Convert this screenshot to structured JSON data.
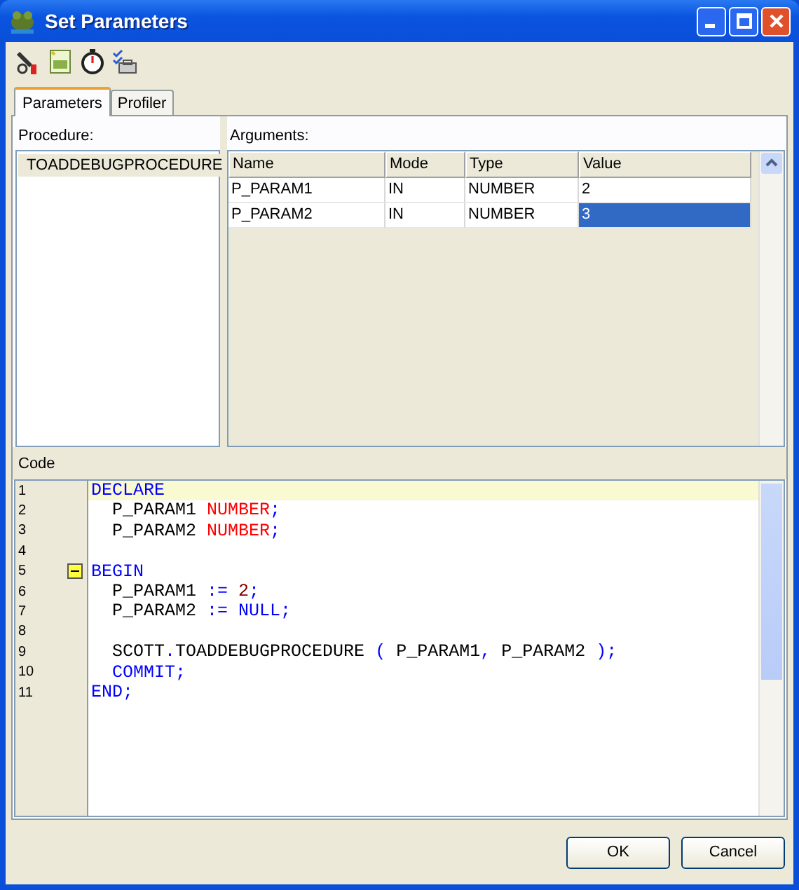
{
  "window": {
    "title": "Set Parameters"
  },
  "tabs": [
    {
      "label": "Parameters",
      "selected": true
    },
    {
      "label": "Profiler",
      "selected": false
    }
  ],
  "procedure": {
    "label": "Procedure:",
    "items": [
      {
        "name": "TOADDEBUGPROCEDURE",
        "selected": true
      }
    ]
  },
  "arguments": {
    "label": "Arguments:",
    "columns": [
      "Name",
      "Mode",
      "Type",
      "Value"
    ],
    "rows": [
      {
        "cells": [
          "P_PARAM1",
          "IN",
          "NUMBER",
          "2"
        ],
        "selected": false
      },
      {
        "cells": [
          "P_PARAM2",
          "IN",
          "NUMBER",
          "3"
        ],
        "selected": true
      }
    ]
  },
  "code": {
    "label": "Code",
    "lines": [
      {
        "number": "1",
        "current": true,
        "fold": false,
        "tokens": [
          {
            "text": "DECLARE",
            "kind": "keyword"
          }
        ]
      },
      {
        "number": "2",
        "current": false,
        "fold": false,
        "tokens": [
          {
            "text": "  P_PARAM1 ",
            "kind": "plain"
          },
          {
            "text": "NUMBER",
            "kind": "type"
          },
          {
            "text": ";",
            "kind": "op"
          }
        ]
      },
      {
        "number": "3",
        "current": false,
        "fold": false,
        "tokens": [
          {
            "text": "  P_PARAM2 ",
            "kind": "plain"
          },
          {
            "text": "NUMBER",
            "kind": "type"
          },
          {
            "text": ";",
            "kind": "op"
          }
        ]
      },
      {
        "number": "4",
        "current": false,
        "fold": false
      },
      {
        "number": "5",
        "current": false,
        "fold": true,
        "tokens": [
          {
            "text": "BEGIN",
            "kind": "keyword"
          }
        ]
      },
      {
        "number": "6",
        "current": false,
        "fold": false,
        "tokens": [
          {
            "text": "  P_PARAM1 ",
            "kind": "plain"
          },
          {
            "text": ":= ",
            "kind": "op"
          },
          {
            "text": "2",
            "kind": "number"
          },
          {
            "text": ";",
            "kind": "op"
          }
        ]
      },
      {
        "number": "7",
        "current": false,
        "fold": false,
        "tokens": [
          {
            "text": "  P_PARAM2 ",
            "kind": "plain"
          },
          {
            "text": ":= NULL;",
            "kind": "keyword"
          }
        ]
      },
      {
        "number": "8",
        "current": false,
        "fold": false
      },
      {
        "number": "9",
        "current": false,
        "fold": false,
        "tokens": [
          {
            "text": "  SCOTT",
            "kind": "plain"
          },
          {
            "text": ".",
            "kind": "op"
          },
          {
            "text": "TOADDEBUGPROCEDURE ",
            "kind": "plain"
          },
          {
            "text": "( ",
            "kind": "op"
          },
          {
            "text": "P_PARAM1",
            "kind": "plain"
          },
          {
            "text": ", ",
            "kind": "op"
          },
          {
            "text": "P_PARAM2 ",
            "kind": "plain"
          },
          {
            "text": ");",
            "kind": "op"
          }
        ]
      },
      {
        "number": "10",
        "current": false,
        "fold": false,
        "tokens": [
          {
            "text": "  COMMIT;",
            "kind": "keyword"
          }
        ]
      },
      {
        "number": "11",
        "current": false,
        "fold": false,
        "tokens": [
          {
            "text": "END;",
            "kind": "keyword"
          }
        ]
      }
    ]
  },
  "buttons": [
    "OK",
    "Cancel"
  ]
}
